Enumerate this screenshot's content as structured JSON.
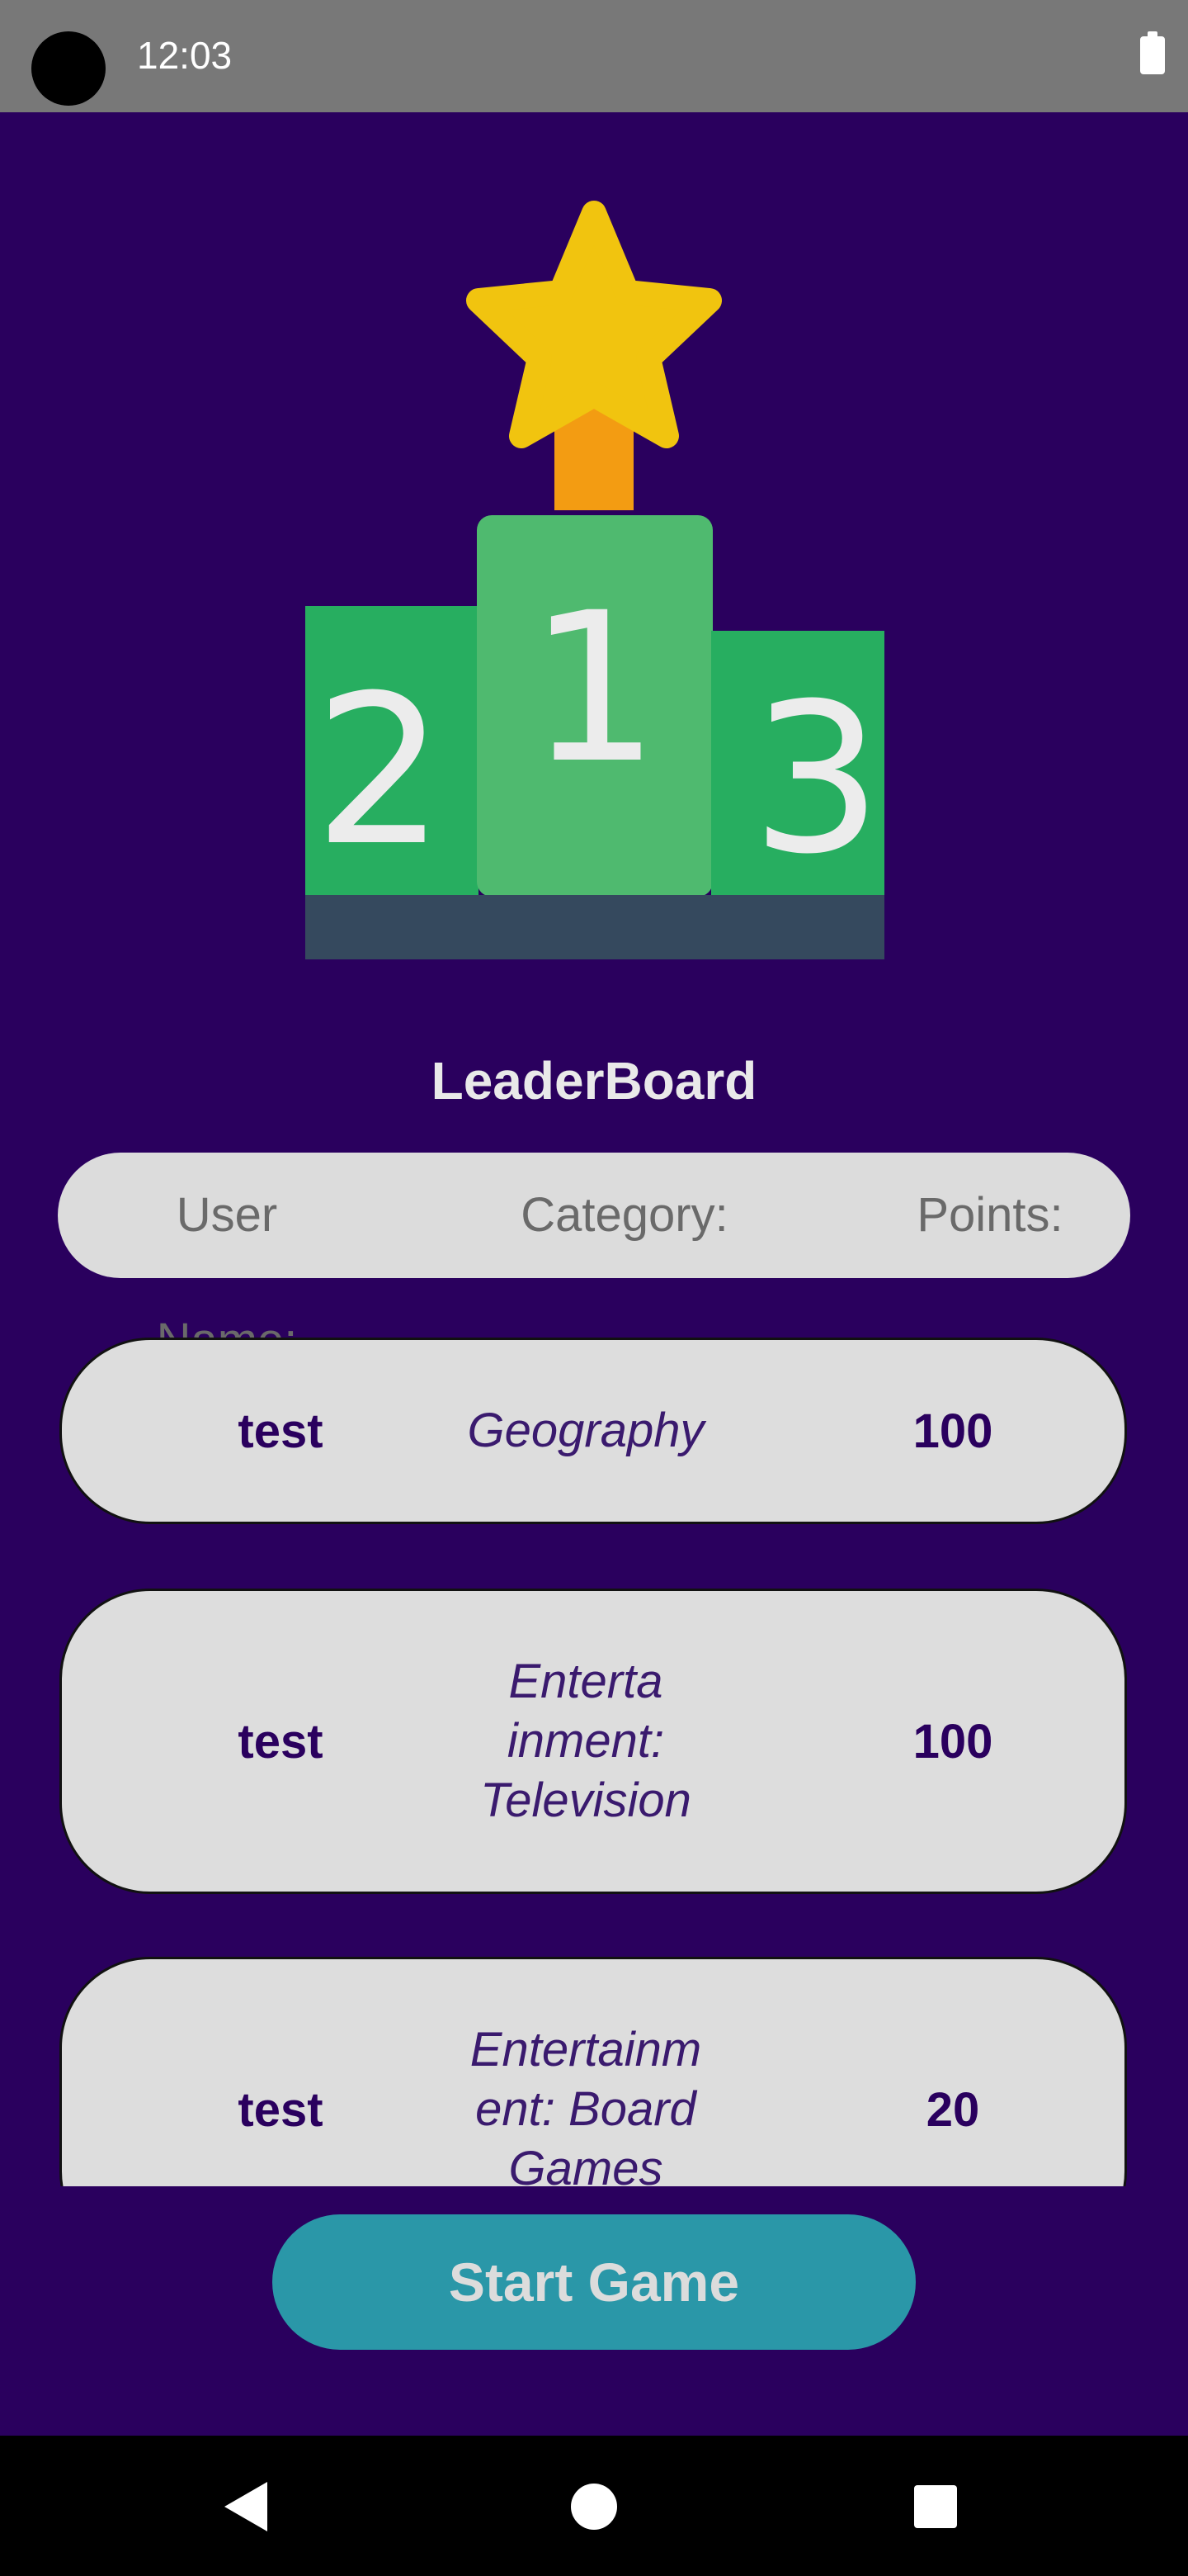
{
  "status_bar": {
    "time": "12:03"
  },
  "hero": {
    "icon": "podium-trophy-icon",
    "places": [
      "2",
      "1",
      "3"
    ]
  },
  "title": "LeaderBoard",
  "header": {
    "user_label": "User Name:",
    "category_label": "Category:",
    "points_label": "Points:"
  },
  "rows": [
    {
      "user": "test",
      "category": "Geography",
      "points": "100"
    },
    {
      "user": "test",
      "category": "Enterta\ninment:\nTelevision",
      "points": "100"
    },
    {
      "user": "test",
      "category": "Entertainm\nent: Board\nGames",
      "points": "20"
    }
  ],
  "start_button": {
    "label": "Start Game"
  },
  "colors": {
    "background": "#2a005e",
    "card": "#dddddd",
    "accent_button": "#2a97a8",
    "podium_green": "#27ae60",
    "podium_center": "#4fba6f",
    "podium_base": "#35495e",
    "star": "#f1c40f",
    "stem": "#f39c12"
  }
}
